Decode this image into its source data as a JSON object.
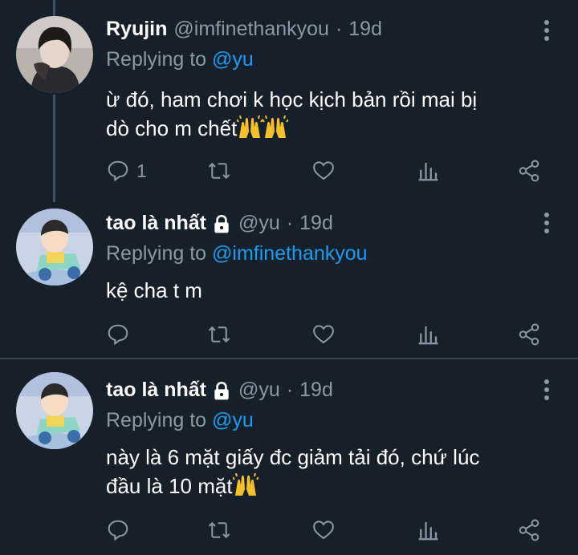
{
  "colors": {
    "background": "#15202b",
    "divider": "#38444d",
    "muted": "#8b98a5",
    "link": "#1d9bf0",
    "text": "#ffffff"
  },
  "tweets": [
    {
      "name": "Ryujin",
      "handle": "@imfinethankyou",
      "separator": "·",
      "time": "19d",
      "protected": false,
      "replying_prefix": "Replying to",
      "replying_to": "@yu",
      "text_lines": [
        "ừ đó, ham chơi k học kịch bản rồi mai bị",
        "dò cho m chết"
      ],
      "emojis": [
        "raising-hands-emoji",
        "raising-hands-emoji"
      ],
      "reply_count": "1"
    },
    {
      "name": "tao là nhất",
      "handle": "@yu",
      "separator": "·",
      "time": "19d",
      "protected": true,
      "replying_prefix": "Replying to",
      "replying_to": "@imfinethankyou",
      "text_lines": [
        "kệ cha t m"
      ],
      "emojis": [],
      "reply_count": ""
    },
    {
      "name": "tao là nhất",
      "handle": "@yu",
      "separator": "·",
      "time": "19d",
      "protected": true,
      "replying_prefix": "Replying to",
      "replying_to": "@yu",
      "text_lines": [
        "này là 6 mặt giấy đc giảm tải đó, chứ lúc",
        "đầu là 10 mặt"
      ],
      "emojis": [
        "raising-hands-emoji"
      ],
      "reply_count": ""
    }
  ],
  "action_icons": [
    "reply-icon",
    "retweet-icon",
    "like-icon",
    "analytics-icon",
    "share-icon"
  ]
}
